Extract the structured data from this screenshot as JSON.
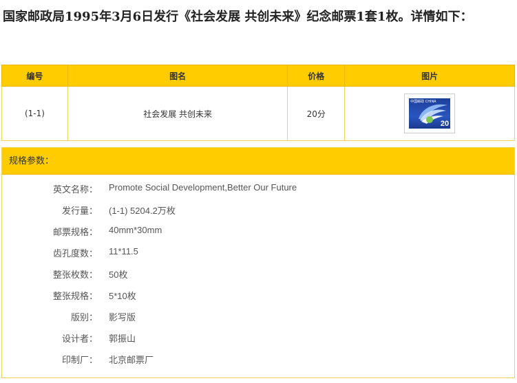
{
  "intro": "国家邮政局1995年3月6日发行《社会发展 共创未来》纪念邮票1套1枚。详情如下：",
  "table": {
    "headers": [
      "编号",
      "图名",
      "价格",
      "图片"
    ],
    "rows": [
      {
        "number": "(1-1)",
        "name": "社会发展  共创未来",
        "price": "20分"
      }
    ]
  },
  "stamp_image": {
    "country": "中国邮政 CHINA",
    "value": "20"
  },
  "spec": {
    "title": "规格参数：",
    "rows": [
      {
        "label": "英文名称：",
        "value": "Promote Social Development,Better Our Future"
      },
      {
        "label": "发行量：",
        "value": "(1-1) 5204.2万枚"
      },
      {
        "label": "邮票规格：",
        "value": "40mm*30mm"
      },
      {
        "label": "齿孔度数：",
        "value": "11*11.5"
      },
      {
        "label": "整张枚数：",
        "value": "50枚"
      },
      {
        "label": "整张规格：",
        "value": "5*10枚"
      },
      {
        "label": "版别：",
        "value": "影写版"
      },
      {
        "label": "设计者：",
        "value": "郭振山"
      },
      {
        "label": "印制厂：",
        "value": "北京邮票厂"
      }
    ]
  },
  "colors": {
    "accent": "#ffcc00",
    "border": "#f0d35a",
    "stamp_blue": "#1d3f9a"
  }
}
